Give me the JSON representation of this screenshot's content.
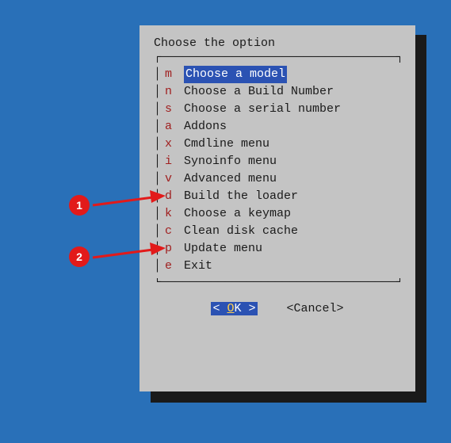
{
  "dialog": {
    "title": "Choose the option",
    "items": [
      {
        "key": "m",
        "label": "Choose a model",
        "selected": true
      },
      {
        "key": "n",
        "label": "Choose a Build Number",
        "selected": false
      },
      {
        "key": "s",
        "label": "Choose a serial number",
        "selected": false
      },
      {
        "key": "a",
        "label": "Addons",
        "selected": false
      },
      {
        "key": "x",
        "label": "Cmdline menu",
        "selected": false
      },
      {
        "key": "i",
        "label": "Synoinfo menu",
        "selected": false
      },
      {
        "key": "v",
        "label": "Advanced menu",
        "selected": false
      },
      {
        "key": "d",
        "label": "Build the loader",
        "selected": false
      },
      {
        "key": "k",
        "label": "Choose a keymap",
        "selected": false
      },
      {
        "key": "c",
        "label": "Clean disk cache",
        "selected": false
      },
      {
        "key": "p",
        "label": "Update menu",
        "selected": false
      },
      {
        "key": "e",
        "label": "Exit",
        "selected": false
      }
    ],
    "buttons": {
      "ok_prefix": "<  ",
      "ok_hot": "O",
      "ok_rest": "K  >",
      "cancel": "<Cancel>"
    }
  },
  "annotations": [
    {
      "num": "1"
    },
    {
      "num": "2"
    }
  ]
}
